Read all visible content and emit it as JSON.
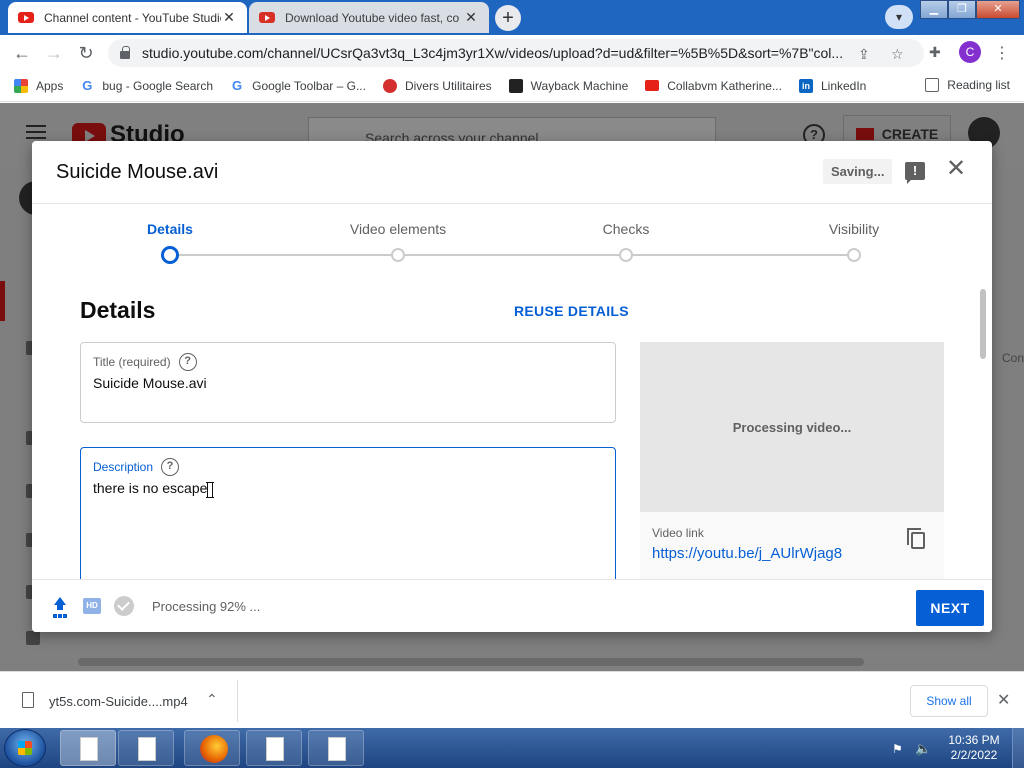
{
  "browser": {
    "tabs": [
      {
        "title": "Channel content - YouTube Studio",
        "active": true
      },
      {
        "title": "Download Youtube video fast, co",
        "active": false
      }
    ],
    "url": "studio.youtube.com/channel/UCsrQa3vt3q_L3c4jm3yr1Xw/videos/upload?d=ud&filter=%5B%5D&sort=%7B\"col...",
    "profile_initial": "C",
    "bookmarks": [
      {
        "label": "Apps",
        "icon": "apps-grid-icon"
      },
      {
        "label": "bug - Google Search",
        "icon": "google-icon"
      },
      {
        "label": "Google Toolbar – G...",
        "icon": "google-icon"
      },
      {
        "label": "Divers Utilitaires",
        "icon": "pin-icon"
      },
      {
        "label": "Wayback Machine",
        "icon": "archive-icon"
      },
      {
        "label": "Collabvm Katherine...",
        "icon": "youtube-icon"
      },
      {
        "label": "LinkedIn",
        "icon": "linkedin-icon"
      }
    ],
    "reading_list": "Reading list"
  },
  "studio": {
    "logo_text": "Studio",
    "search_placeholder": "Search across your channel",
    "create_label": "CREATE",
    "side_text": "Con"
  },
  "dialog": {
    "title": "Suicide Mouse.avi",
    "saving_label": "Saving...",
    "steps": [
      {
        "label": "Details",
        "active": true
      },
      {
        "label": "Video elements",
        "active": false
      },
      {
        "label": "Checks",
        "active": false
      },
      {
        "label": "Visibility",
        "active": false
      }
    ],
    "section_heading": "Details",
    "reuse_label": "REUSE DETAILS",
    "title_field": {
      "label": "Title (required)",
      "value": "Suicide Mouse.avi"
    },
    "description_field": {
      "label": "Description",
      "value": "there is no escape"
    },
    "preview_status": "Processing video...",
    "video_link_label": "Video link",
    "video_link_url": "https://youtu.be/j_AUlrWjag8",
    "footer_status": "Processing 92% ...",
    "processing_percent": 92,
    "next_label": "NEXT",
    "accent_color": "#065fd4"
  },
  "download_bar": {
    "file_name": "yt5s.com-Suicide....mp4",
    "show_all": "Show all"
  },
  "taskbar": {
    "time": "10:36 PM",
    "date": "2/2/2022"
  }
}
